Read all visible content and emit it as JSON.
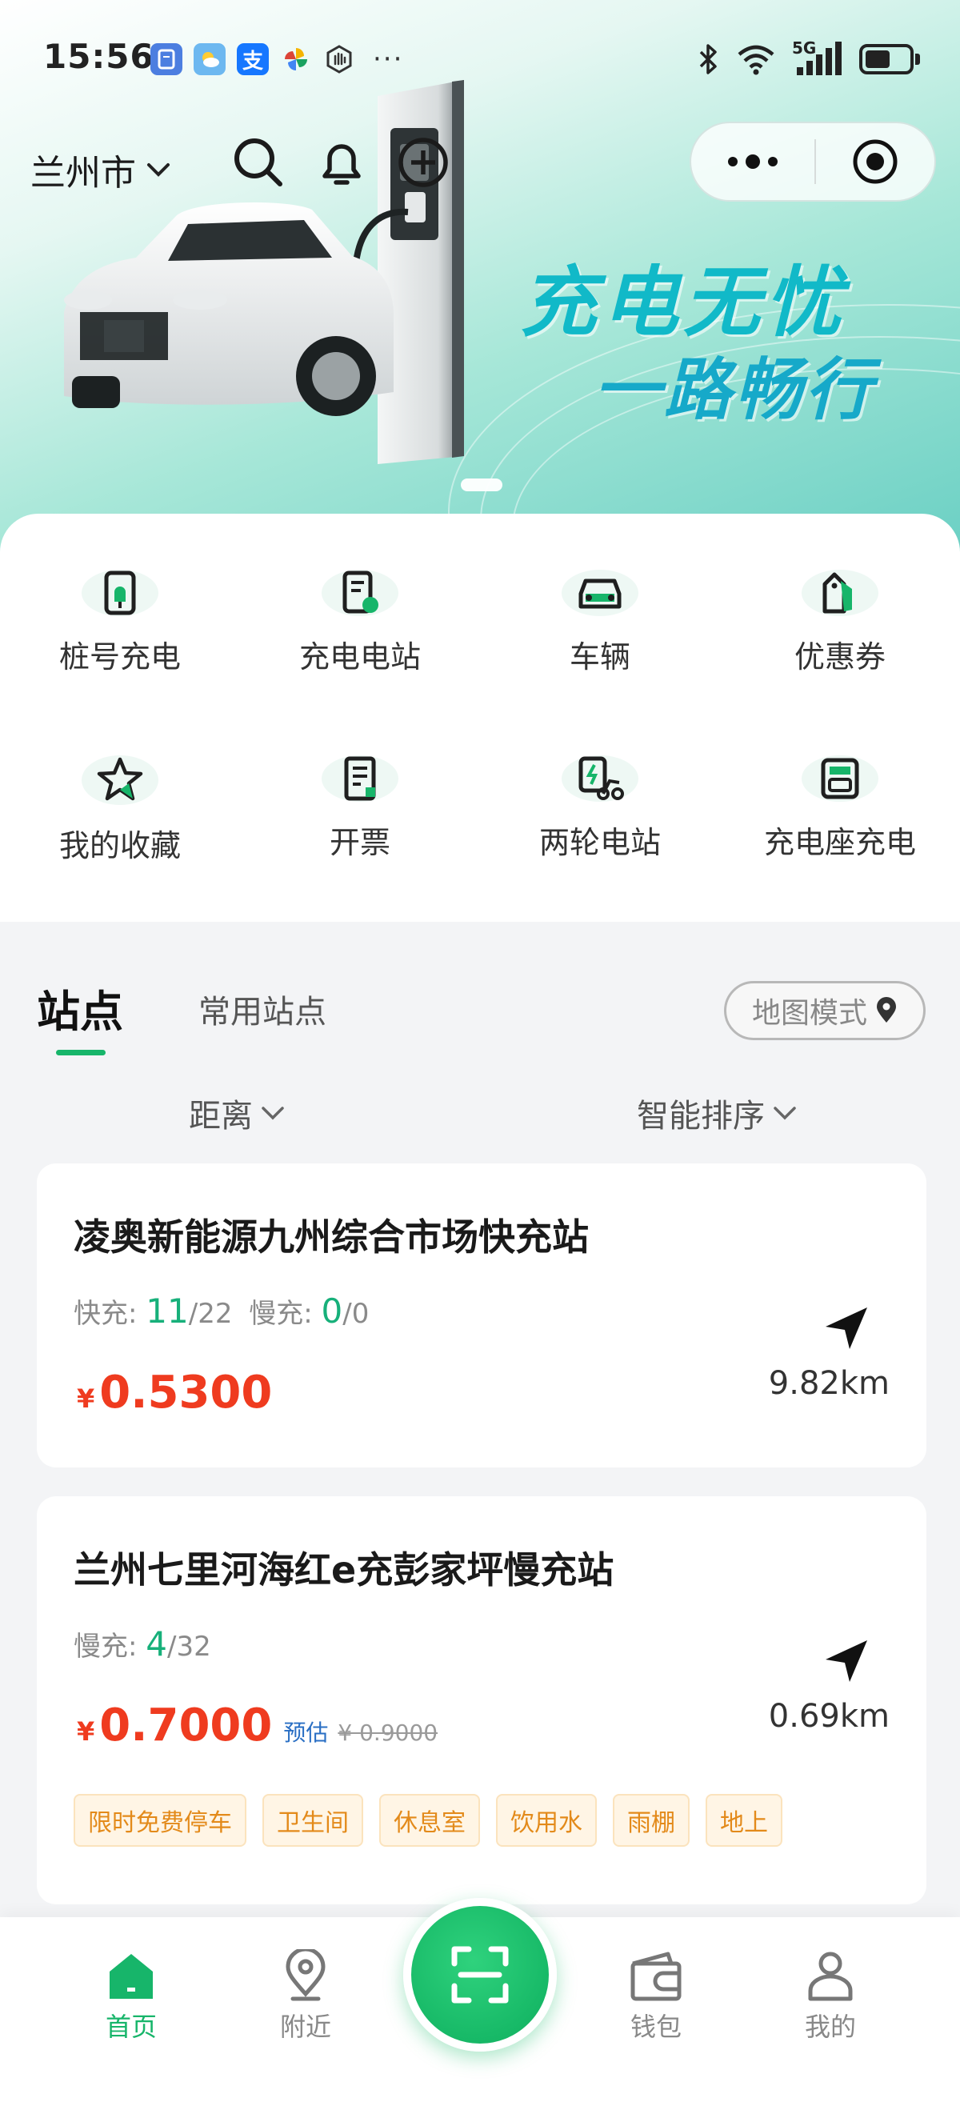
{
  "status_bar": {
    "time": "15:56",
    "app_icons": [
      "notes-icon",
      "weather-icon",
      "alipay-icon",
      "pinwheel-icon",
      "hand-icon"
    ],
    "more": "···",
    "signal_label": "5G",
    "system_icons": [
      "bluetooth-icon",
      "wifi-icon",
      "signal-icon",
      "battery-icon"
    ]
  },
  "header": {
    "city": "兰州市",
    "icons": [
      "search-icon",
      "bell-icon",
      "plus-circle-icon"
    ],
    "capsule": {
      "more_icon": "more-dots-icon",
      "close_icon": "target-icon"
    }
  },
  "banner": {
    "line1": "充电无忧",
    "line2": "一路畅行"
  },
  "menu": [
    {
      "label": "桩号充电",
      "icon": "charger-pile-icon"
    },
    {
      "label": "充电电站",
      "icon": "charging-station-icon"
    },
    {
      "label": "车辆",
      "icon": "car-icon"
    },
    {
      "label": "优惠券",
      "icon": "coupon-tag-icon"
    },
    {
      "label": "我的收藏",
      "icon": "star-icon"
    },
    {
      "label": "开票",
      "icon": "invoice-icon"
    },
    {
      "label": "两轮电站",
      "icon": "scooter-station-icon"
    },
    {
      "label": "充电座充电",
      "icon": "charging-dock-icon"
    }
  ],
  "stations": {
    "tab_active": "站点",
    "tab_other": "常用站点",
    "map_mode": "地图模式",
    "filter_distance": "距离",
    "filter_sort": "智能排序",
    "list": [
      {
        "name": "凌奥新能源九州综合市场快充站",
        "fast_label": "快充:",
        "fast_available": "11",
        "fast_total": "/22",
        "slow_label": "慢充:",
        "slow_available": "0",
        "slow_total": "/0",
        "currency": "¥",
        "price": "0.5300",
        "distance": "9.82km"
      },
      {
        "name": "兰州七里河海红e充彭家坪慢充站",
        "slow_label": "慢充:",
        "slow_available": "4",
        "slow_total": "/32",
        "currency": "¥",
        "price": "0.7000",
        "estimate": "预估",
        "original_price": "¥ 0.9000",
        "distance": "0.69km",
        "tags": [
          "限时免费停车",
          "卫生间",
          "休息室",
          "饮用水",
          "雨棚",
          "地上"
        ]
      }
    ]
  },
  "bottom_nav": {
    "items": [
      {
        "label": "首页",
        "icon": "home-icon",
        "active": true
      },
      {
        "label": "附近",
        "icon": "location-pin-icon",
        "active": false
      },
      {
        "label": "钱包",
        "icon": "wallet-icon",
        "active": false
      },
      {
        "label": "我的",
        "icon": "person-icon",
        "active": false
      }
    ],
    "scan_icon": "scan-icon"
  },
  "colors": {
    "brand_green": "#17b56a",
    "price_red": "#ef3b1f",
    "availability_green": "#17b07a",
    "tag_orange": "#e38a1a"
  }
}
